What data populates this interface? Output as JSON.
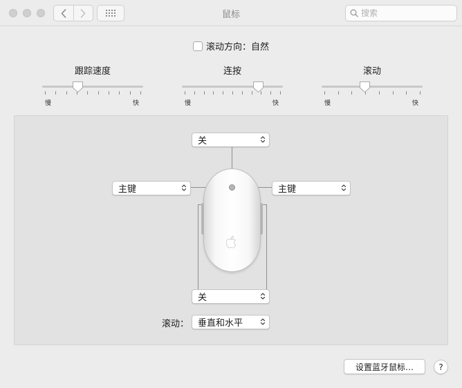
{
  "window": {
    "title": "鼠标"
  },
  "toolbar": {
    "search_placeholder": "搜索"
  },
  "scroll_direction": {
    "label": "滚动方向：自然",
    "checked": false
  },
  "sliders": [
    {
      "title": "跟踪速度",
      "min_label": "慢",
      "max_label": "快",
      "ticks": 10,
      "value_fraction": 0.35
    },
    {
      "title": "连按",
      "min_label": "慢",
      "max_label": "快",
      "ticks": 11,
      "value_fraction": 0.76
    },
    {
      "title": "滚动",
      "min_label": "慢",
      "max_label": "快",
      "ticks": 8,
      "value_fraction": 0.43
    }
  ],
  "buttons": {
    "top": "关",
    "left": "主键",
    "right": "主键",
    "bottom": "关"
  },
  "scroll": {
    "label": "滚动：",
    "value": "垂直和水平"
  },
  "footer": {
    "setup_label": "设置蓝牙鼠标…",
    "help_label": "?"
  }
}
